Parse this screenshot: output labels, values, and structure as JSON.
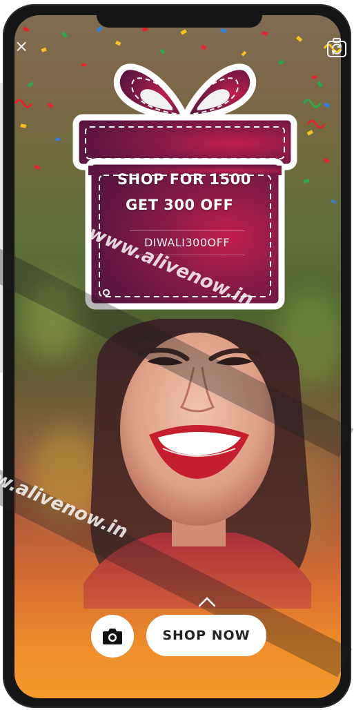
{
  "offer": {
    "line1": "SHOP FOR 1500",
    "line2": "GET 300 OFF",
    "coupon_code": "DIWALI300OFF"
  },
  "watermark": {
    "upper": "www.alivenow.in",
    "lower": "w.alivenow.in"
  },
  "controls": {
    "close_glyph": "×",
    "shop_label": "SHOP NOW",
    "camera_icon": "camera-icon",
    "flip_icon": "camera-flip-icon",
    "chevron_icon": "chevron-up-icon"
  },
  "colors": {
    "gift_fill": "#6d1744",
    "gift_highlight": "#c21f4e",
    "gift_outline": "#ffffff",
    "button_bg": "#ffffff",
    "button_text": "#222222",
    "bottom_gradient": "#f29b2d"
  }
}
